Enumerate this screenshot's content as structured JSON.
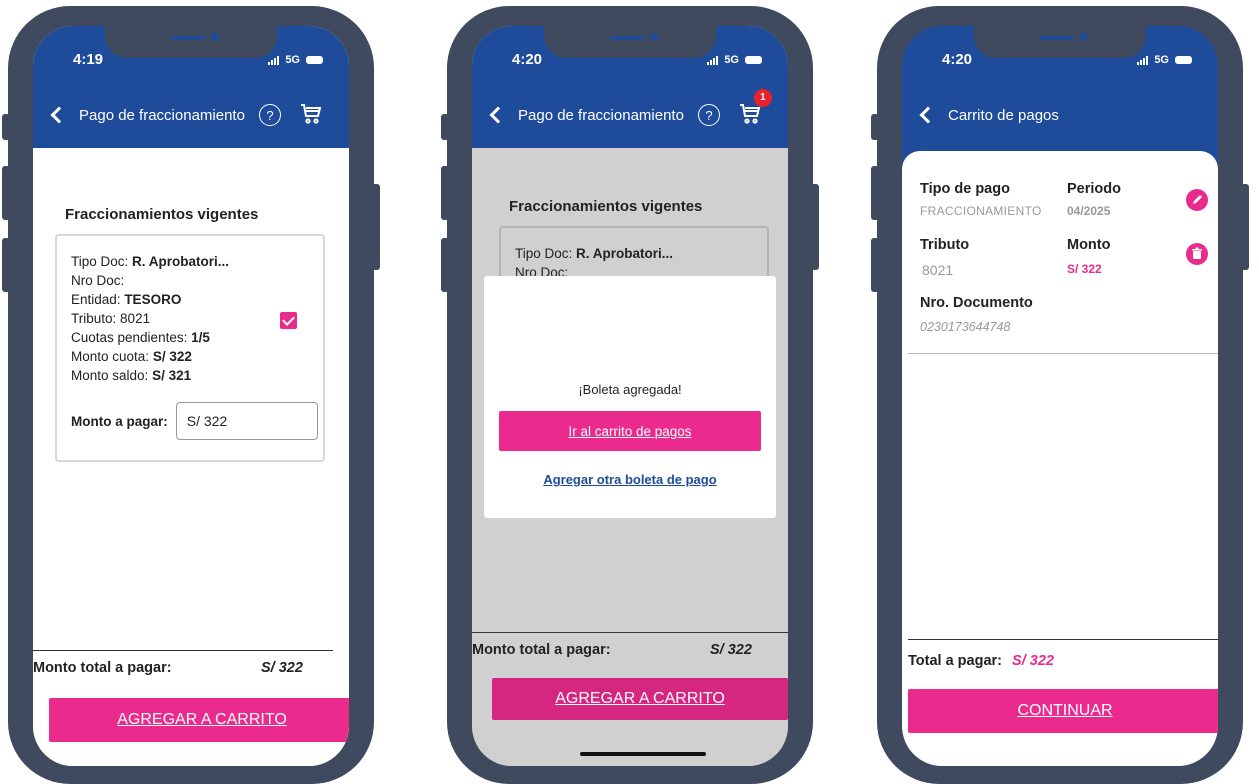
{
  "screen1": {
    "status": {
      "time": "4:19",
      "network": "5G"
    },
    "header": {
      "title": "Pago de fraccionamiento",
      "help_icon": "help-circle-icon",
      "cart_icon": "shopping-cart-icon"
    },
    "section_title": "Fraccionamientos vigentes",
    "card": {
      "tipo_doc_label": "Tipo Doc:",
      "tipo_doc_value": "R. Aprobatori...",
      "nro_doc_label": "Nro Doc:",
      "entidad_label": "Entidad:",
      "entidad_value": "TESORO",
      "tributo_label": "Tributo:",
      "tributo_value": "8021",
      "cuotas_label": "Cuotas pendientes:",
      "cuotas_value": "1/5",
      "monto_cuota_label": "Monto cuota:",
      "monto_cuota_value": "S/ 322",
      "monto_saldo_label": "Monto saldo:",
      "monto_saldo_value": "S/ 321",
      "checked": true,
      "monto_pagar_label": "Monto a pagar:",
      "monto_pagar_value": "S/ 322"
    },
    "total_label": "Monto total a pagar:",
    "total_value": "S/ 322",
    "button": "AGREGAR A CARRITO"
  },
  "screen2": {
    "status": {
      "time": "4:20",
      "network": "5G"
    },
    "header": {
      "title": "Pago de fraccionamiento",
      "cart_badge": "1"
    },
    "section_title": "Fraccionamientos vigentes",
    "card": {
      "tipo_doc_label": "Tipo Doc:",
      "tipo_doc_value": "R. Aprobatori...",
      "nro_doc_label": "Nro Doc:"
    },
    "modal": {
      "title": "¡Boleta agregada!",
      "primary": "Ir al carrito de pagos",
      "link": "Agregar otra boleta de pago"
    },
    "total_label": "Monto total a pagar:",
    "total_value": "S/ 322",
    "button": "AGREGAR A CARRITO"
  },
  "screen3": {
    "status": {
      "time": "4:20",
      "network": "5G"
    },
    "header": {
      "title": "Carrito de pagos"
    },
    "item": {
      "tipo_pago_label": "Tipo de pago",
      "tipo_pago_value": "FRACCIONAMIENTO",
      "periodo_label": "Periodo",
      "periodo_value": "04/2025",
      "tributo_label": "Tributo",
      "tributo_value": "8021",
      "monto_label": "Monto",
      "monto_value": "S/ 322",
      "documento_label": "Nro. Documento",
      "documento_value": "0230173644748"
    },
    "total_label": "Total a pagar:",
    "total_value": "S/ 322",
    "button": "CONTINUAR"
  },
  "colors": {
    "brand_blue": "#1e4c9a",
    "accent_pink": "#ea2a8c",
    "frame": "#3f4a5e",
    "badge_red": "#e8212d"
  }
}
